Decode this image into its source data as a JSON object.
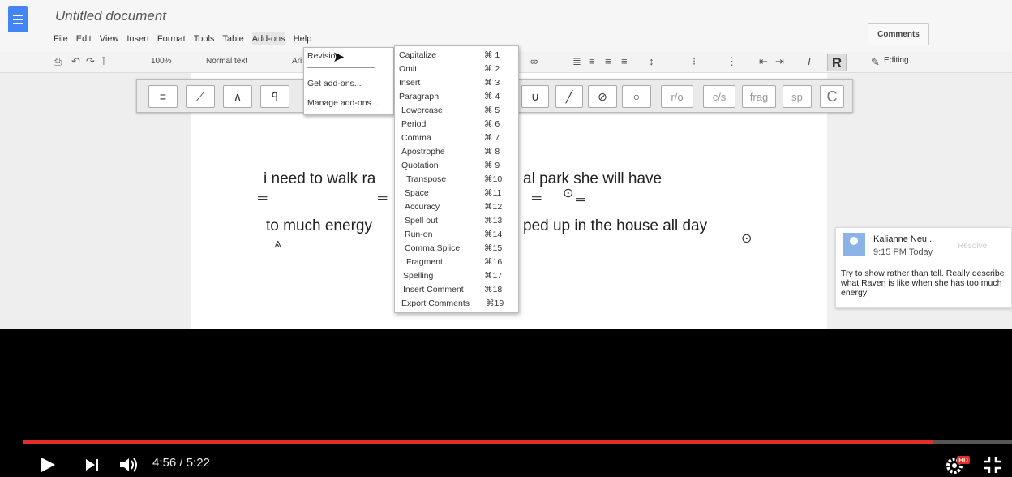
{
  "doc": {
    "title": "Untitled document",
    "menu": [
      "File",
      "Edit",
      "View",
      "Insert",
      "Format",
      "Tools",
      "Table",
      "Add-ons",
      "Help"
    ],
    "comments_label": "Comments",
    "toolbar": {
      "zoom": "100%",
      "style": "Normal text",
      "font": "Ari",
      "bold_label": "R",
      "editing_label": "Editing"
    }
  },
  "revision_toolbar": [
    "≡",
    "⟋",
    "∧",
    "ꟼ",
    "∪",
    "╱",
    "⊘",
    "○",
    "r/o",
    "c/s",
    "frag",
    "sp",
    "C"
  ],
  "addons_menu": {
    "items": [
      "Revision",
      "Get add-ons...",
      "Manage add-ons..."
    ]
  },
  "revision_menu": [
    {
      "label": "Capitalize",
      "shortcut": "⌘ 1"
    },
    {
      "label": "Omit",
      "shortcut": "⌘ 2"
    },
    {
      "label": "Insert",
      "shortcut": "⌘ 3"
    },
    {
      "label": "Paragraph",
      "shortcut": "⌘ 4"
    },
    {
      "label": "Lowercase",
      "shortcut": "⌘ 5"
    },
    {
      "label": "Period",
      "shortcut": "⌘ 6"
    },
    {
      "label": "Comma",
      "shortcut": "⌘ 7"
    },
    {
      "label": "Apostrophe",
      "shortcut": "⌘ 8"
    },
    {
      "label": "Quotation",
      "shortcut": "⌘ 9"
    },
    {
      "label": "Transpose",
      "shortcut": "⌘10"
    },
    {
      "label": "Space",
      "shortcut": "⌘11"
    },
    {
      "label": "Accuracy",
      "shortcut": "⌘12"
    },
    {
      "label": "Spell out",
      "shortcut": "⌘13"
    },
    {
      "label": "Run-on",
      "shortcut": "⌘14"
    },
    {
      "label": "Comma Splice",
      "shortcut": "⌘15"
    },
    {
      "label": "Fragment",
      "shortcut": "⌘16"
    },
    {
      "label": "Spelling",
      "shortcut": "⌘17"
    },
    {
      "label": "Insert Comment",
      "shortcut": "⌘18"
    },
    {
      "label": "Export Comments",
      "shortcut": "⌘19"
    }
  ],
  "document_text": {
    "line1a": "i need to walk ra",
    "line1b": "al park she will have",
    "line2a": "to much energy",
    "line2b": "ped up in the house all day"
  },
  "comment": {
    "author": "Kalianne Neu...",
    "time": "9:15 PM Today",
    "resolve": "Resolve",
    "text": "Try to show rather than tell. Really describe what Raven is like when she has too much energy"
  },
  "player": {
    "current_time": "4:56",
    "duration": "5:22",
    "time_display": "4:56 / 5:22",
    "progress": 0.92,
    "hd_badge": "HD",
    "colors": {
      "progress": "#e52d27",
      "background": "#000000"
    }
  }
}
